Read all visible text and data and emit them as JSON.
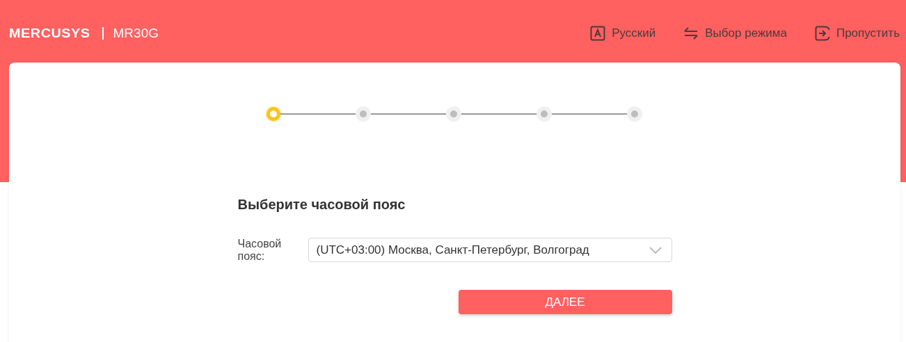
{
  "header": {
    "brand": "MERCUSYS",
    "model": "MR30G",
    "actions": [
      {
        "kind": "language",
        "label": "Русский"
      },
      {
        "kind": "mode",
        "label": "Выбор режима"
      },
      {
        "kind": "skip",
        "label": "Пропустить"
      }
    ]
  },
  "steps": [
    {
      "selected": true
    },
    {
      "selected": false
    },
    {
      "selected": false
    },
    {
      "selected": false
    },
    {
      "selected": false
    }
  ],
  "form": {
    "title": "Выберите часовой пояс",
    "timezone_label": "Часовой пояс:",
    "timezone_value": "(UTC+03:00) Москва, Санкт-Петербург, Волгоград",
    "next_button": "ДАЛЕЕ"
  }
}
